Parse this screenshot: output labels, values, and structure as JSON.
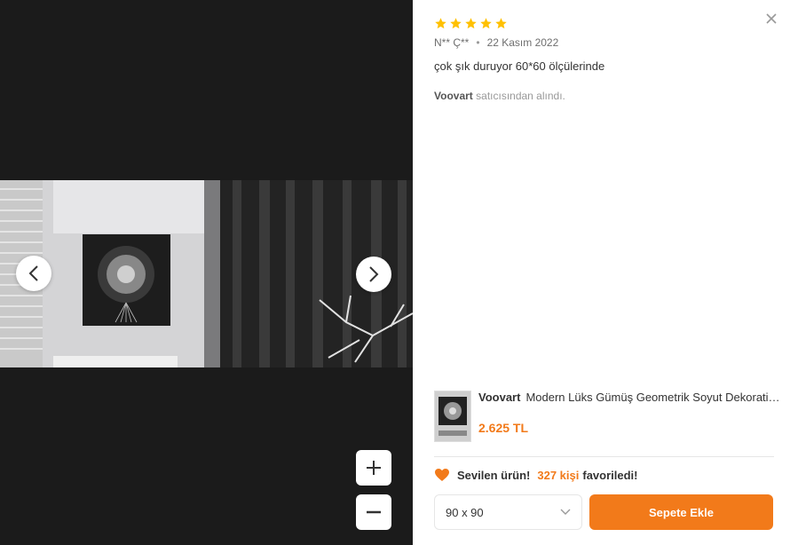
{
  "review": {
    "rating": 5,
    "author": "N** Ç**",
    "date": "22 Kasım 2022",
    "text": "çok şık duruyor 60*60 ölçülerinde",
    "seller_name": "Voovart",
    "seller_suffix": "satıcısından alındı."
  },
  "product": {
    "brand": "Voovart",
    "title": "Modern Lüks Gümüş Geometrik Soyut Dekoratif Kanvas Tablo",
    "price": "2.625 TL"
  },
  "favorites": {
    "label_prefix": "Sevilen ürün!",
    "count": "327 kişi",
    "label_suffix": "favoriledi!"
  },
  "size_select": {
    "selected": "90 x 90"
  },
  "cart": {
    "add_label": "Sepete Ekle"
  },
  "colors": {
    "accent": "#f27a1a",
    "star": "#ffc000",
    "viewer_bg": "#1b1b1b"
  },
  "icons": {
    "close": "close-icon",
    "prev": "chevron-left-icon",
    "next": "chevron-right-icon",
    "zoom_in": "plus-icon",
    "zoom_out": "minus-icon",
    "heart": "heart-icon",
    "dropdown": "chevron-down-icon"
  }
}
